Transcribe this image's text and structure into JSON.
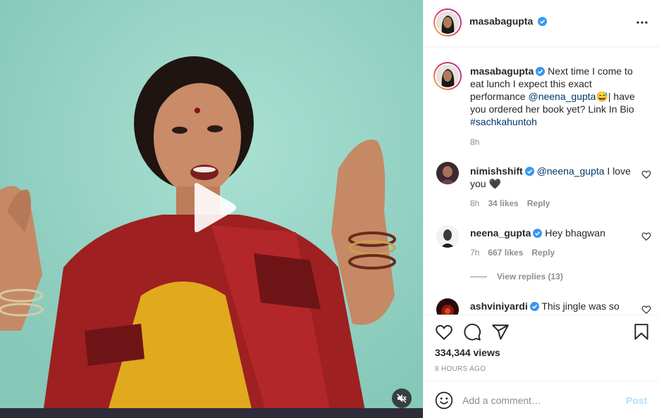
{
  "post": {
    "author": "masabagupta",
    "caption": {
      "author": "masabagupta",
      "text_1": " Next time I come to eat lunch I expect this exact performance ",
      "mention": "@neena_gupta",
      "emoji": "😅",
      "text_2": "| have you ordered her book yet? Link In Bio ",
      "hashtag": "#sachkahuntoh",
      "time": "8h"
    },
    "comments": [
      {
        "author": "nimishshift",
        "mention": "@neena_gupta",
        "text": " I love you 🖤",
        "time": "8h",
        "likes": "34 likes",
        "reply": "Reply"
      },
      {
        "author": "neena_gupta",
        "text": " Hey bhagwan",
        "time": "7h",
        "likes": "667 likes",
        "reply": "Reply",
        "view_replies": "View replies (13)"
      },
      {
        "author": "ashviniyardi",
        "text": " This jingle was so"
      }
    ],
    "views": "334,344 views",
    "ago": "8 HOURS AGO",
    "add_comment": {
      "placeholder": "Add a comment…",
      "post_label": "Post"
    }
  },
  "colors": {
    "verified": "#3897f0",
    "link": "#00376b",
    "post_disabled": "#b2dffc",
    "video_bg": "#95d4c6"
  },
  "icons": [
    "play-icon",
    "mute-icon",
    "more-icon",
    "verified-icon",
    "heart-icon",
    "comment-icon",
    "share-icon",
    "bookmark-icon",
    "emoji-icon"
  ]
}
